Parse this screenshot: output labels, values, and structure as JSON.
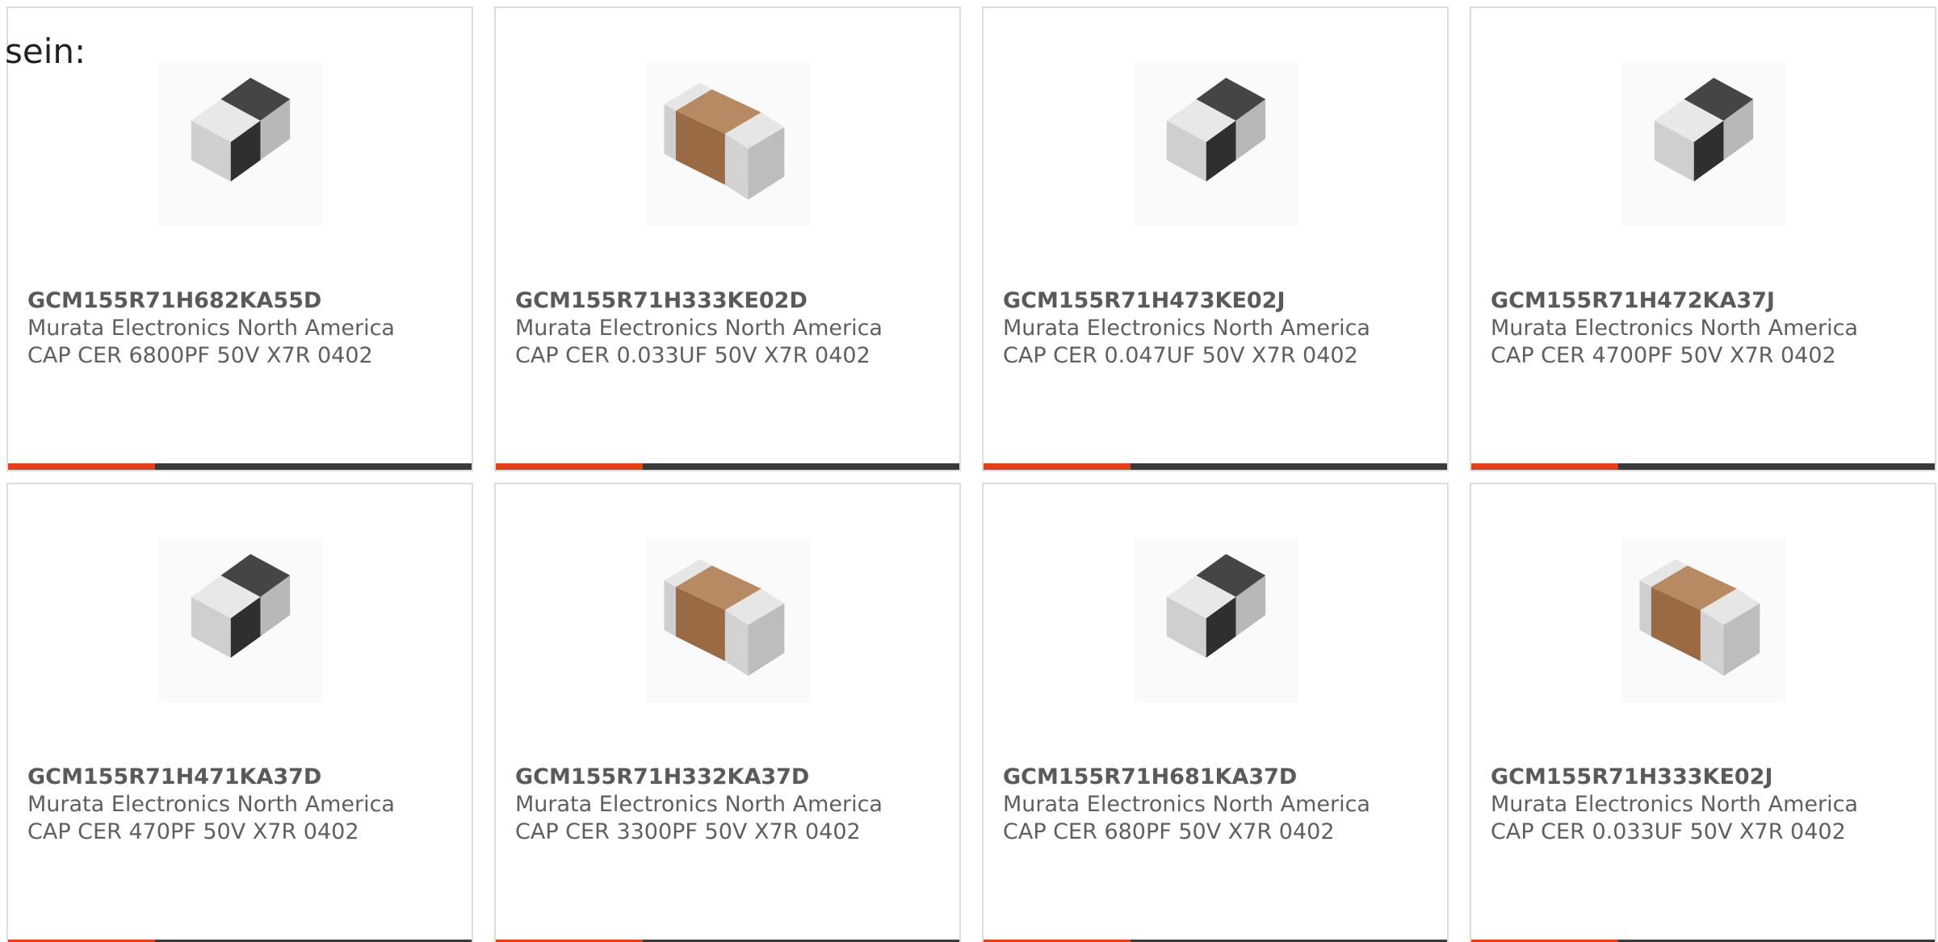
{
  "intro": {
    "text": "sein:"
  },
  "theme": {
    "accent_color": "#e0411a",
    "bar_color": "#3a3a3a",
    "brown_capacitor_body": "#9a6a44",
    "dark_capacitor_body": "#3a3a3a",
    "terminal_color": "#d8d8d8"
  },
  "products": [
    {
      "part_number": "GCM155R71H682KA55D",
      "manufacturer": "Murata Electronics North America",
      "description": "CAP CER 6800PF 50V X7R 0402",
      "image_icon": "capacitor-dark-icon"
    },
    {
      "part_number": "GCM155R71H333KE02D",
      "manufacturer": "Murata Electronics North America",
      "description": "CAP CER 0.033UF 50V X7R 0402",
      "image_icon": "capacitor-brown-icon"
    },
    {
      "part_number": "GCM155R71H473KE02J",
      "manufacturer": "Murata Electronics North America",
      "description": "CAP CER 0.047UF 50V X7R 0402",
      "image_icon": "capacitor-dark-icon"
    },
    {
      "part_number": "GCM155R71H472KA37J",
      "manufacturer": "Murata Electronics North America",
      "description": "CAP CER 4700PF 50V X7R 0402",
      "image_icon": "capacitor-dark-icon"
    },
    {
      "part_number": "GCM155R71H471KA37D",
      "manufacturer": "Murata Electronics North America",
      "description": "CAP CER 470PF 50V X7R 0402",
      "image_icon": "capacitor-dark-icon"
    },
    {
      "part_number": "GCM155R71H332KA37D",
      "manufacturer": "Murata Electronics North America",
      "description": "CAP CER 3300PF 50V X7R 0402",
      "image_icon": "capacitor-brown-icon"
    },
    {
      "part_number": "GCM155R71H681KA37D",
      "manufacturer": "Murata Electronics North America",
      "description": "CAP CER 680PF 50V X7R 0402",
      "image_icon": "capacitor-dark-icon"
    },
    {
      "part_number": "GCM155R71H333KE02J",
      "manufacturer": "Murata Electronics North America",
      "description": "CAP CER 0.033UF 50V X7R 0402",
      "image_icon": "capacitor-brown-icon"
    }
  ]
}
